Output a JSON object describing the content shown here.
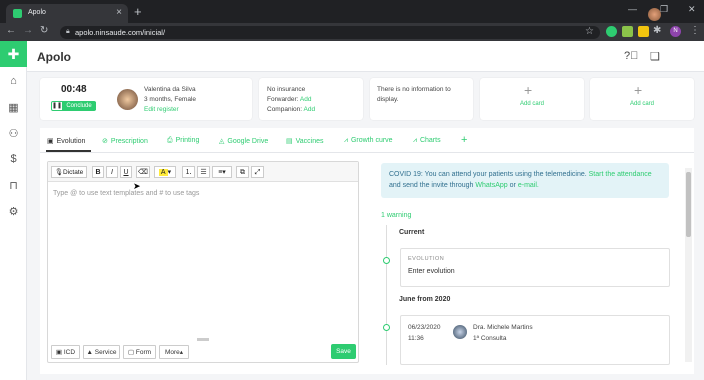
{
  "browser": {
    "tab_title": "Apolo",
    "url": "apolo.ninsaude.com/inicial/",
    "profile_initial": "N"
  },
  "app": {
    "brand": "Apolo"
  },
  "patient_bar": {
    "timer": "00:48",
    "conclude": "Conclude",
    "name": "Valentina da Silva",
    "age_sex": "3 months, Female",
    "edit": "Edit register",
    "insurance": "No insurance",
    "forwarder_label": "Forwarder:",
    "forwarder_add": "Add",
    "companion_label": "Companion:",
    "companion_add": "Add",
    "info_line1": "There is no information to",
    "info_line2": "display.",
    "add_card_1": "Add card",
    "add_card_2": "Add card"
  },
  "tabs": [
    "Evolution",
    "Prescription",
    "Printing",
    "Google Drive",
    "Vaccines",
    "Growth curve",
    "Charts"
  ],
  "editor": {
    "dictate": "Dictate",
    "placeholder": "Type @ to use text templates and # to use tags",
    "bottom": {
      "icd": "ICD",
      "service": "Service",
      "form": "Form",
      "more": "More",
      "save": "Save"
    }
  },
  "timeline": {
    "covid_text1": "COVID 19: You can attend your patients using the telemedicine.",
    "covid_link1": "Start the",
    "covid_link1b": "attendance",
    "covid_text2": "and send the invite through",
    "covid_link2": "WhatsApp",
    "covid_or": "or",
    "covid_link3": "e-mail.",
    "warning": "1 warning",
    "current": "Current",
    "evolution_label": "EVOLUTION",
    "enter_evolution": "Enter evolution",
    "group": "June from 2020",
    "date": "06/23/2020",
    "time": "11:36",
    "doctor": "Dra. Michele Martins",
    "consult": "1ª Consulta"
  }
}
